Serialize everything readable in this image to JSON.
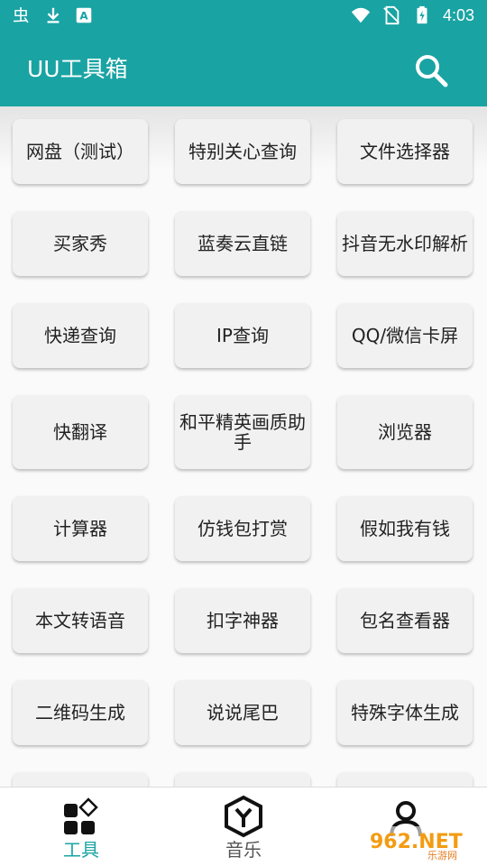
{
  "status_bar": {
    "time": "4:03",
    "left_icons": [
      "bug-icon",
      "download-icon",
      "notification-a-icon"
    ],
    "right_icons": [
      "wifi-icon",
      "no-sim-icon",
      "battery-charging-icon"
    ]
  },
  "app_bar": {
    "title": "UU工具箱",
    "search_icon": "search-icon",
    "color": "#1aa3a3"
  },
  "tools": [
    {
      "label": "网盘（测试）"
    },
    {
      "label": "特别关心查询"
    },
    {
      "label": "文件选择器"
    },
    {
      "label": "买家秀"
    },
    {
      "label": "蓝奏云直链"
    },
    {
      "label": "抖音无水印解析"
    },
    {
      "label": "快递查询"
    },
    {
      "label": "IP查询"
    },
    {
      "label": "QQ/微信卡屏"
    },
    {
      "label": "快翻译"
    },
    {
      "label": "和平精英画质助手"
    },
    {
      "label": "浏览器"
    },
    {
      "label": "计算器"
    },
    {
      "label": "仿钱包打赏"
    },
    {
      "label": "假如我有钱"
    },
    {
      "label": "本文转语音"
    },
    {
      "label": "扣字神器"
    },
    {
      "label": "包名查看器"
    },
    {
      "label": "二维码生成"
    },
    {
      "label": "说说尾巴"
    },
    {
      "label": "特殊字体生成"
    }
  ],
  "bottom_nav": {
    "items": [
      {
        "label": "工具",
        "icon": "tools-grid-icon",
        "active": true
      },
      {
        "label": "音乐",
        "icon": "music-cube-icon",
        "active": false
      },
      {
        "label": "",
        "icon": "profile-icon",
        "active": false
      }
    ],
    "active_color": "#1aa3a3"
  },
  "watermark": {
    "text": "962.NET",
    "subtext": "乐游网"
  }
}
